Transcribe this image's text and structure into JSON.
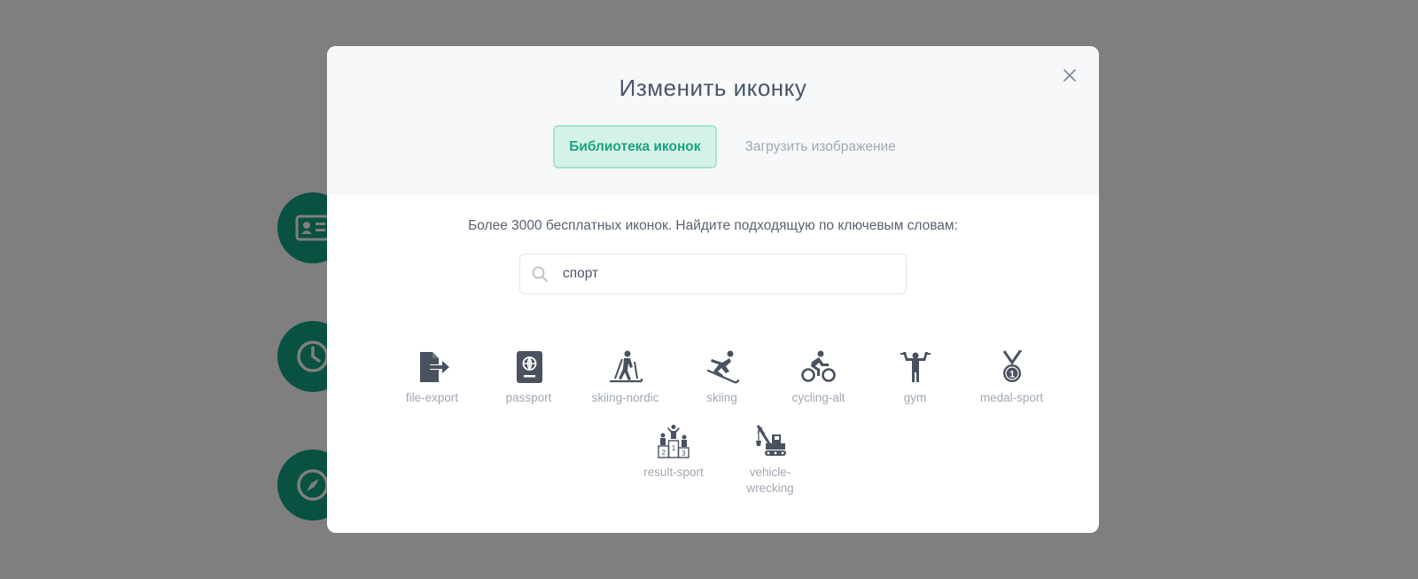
{
  "modal": {
    "title": "Изменить иконку",
    "tabs": [
      {
        "label": "Библиотека иконок",
        "active": true
      },
      {
        "label": "Загрузить изображение",
        "active": false
      }
    ],
    "hint": "Более 3000 бесплатных иконок. Найдите подходящую по ключевым словам:",
    "search": {
      "value": "спорт"
    },
    "icons": [
      {
        "label": "file-export",
        "icon": "file-export-icon"
      },
      {
        "label": "passport",
        "icon": "passport-icon"
      },
      {
        "label": "skiing-nordic",
        "icon": "skiing-nordic-icon"
      },
      {
        "label": "skiing",
        "icon": "skiing-icon"
      },
      {
        "label": "cycling-alt",
        "icon": "cycling-alt-icon"
      },
      {
        "label": "gym",
        "icon": "gym-icon"
      },
      {
        "label": "medal-sport",
        "icon": "medal-sport-icon"
      },
      {
        "label": "result-sport",
        "icon": "result-sport-icon"
      },
      {
        "label": "vehicle-wrecking",
        "icon": "vehicle-wrecking-icon"
      }
    ]
  },
  "background": {
    "icons": [
      "id-card-icon",
      "clock-icon",
      "compass-icon"
    ]
  },
  "colors": {
    "accent": "#19a383",
    "icon": "#4a5260",
    "overlay": "rgba(0,0,0,0.5)"
  }
}
